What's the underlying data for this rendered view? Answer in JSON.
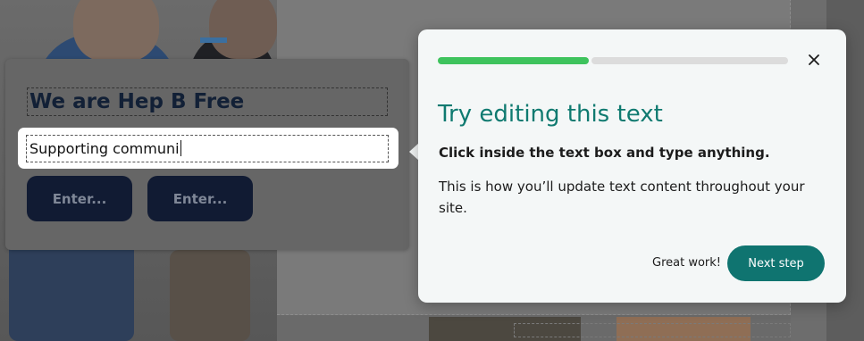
{
  "editor": {
    "headline": "We are Hep B Free",
    "text_input_value": "Supporting communi",
    "buttons": [
      "Enter...",
      "Enter..."
    ]
  },
  "tour": {
    "progress_fraction": 0.43,
    "title": "Try editing this text",
    "subtitle": "Click inside the text box and type anything.",
    "body": "This is how you’ll update text content throughout your site.",
    "feedback": "Great work!",
    "next_label": "Next step",
    "close_icon": "close-icon"
  },
  "colors": {
    "accent_teal": "#0f7470",
    "title_teal": "#0f7a70",
    "progress_green": "#3ec35d",
    "button_navy": "#111b33"
  }
}
